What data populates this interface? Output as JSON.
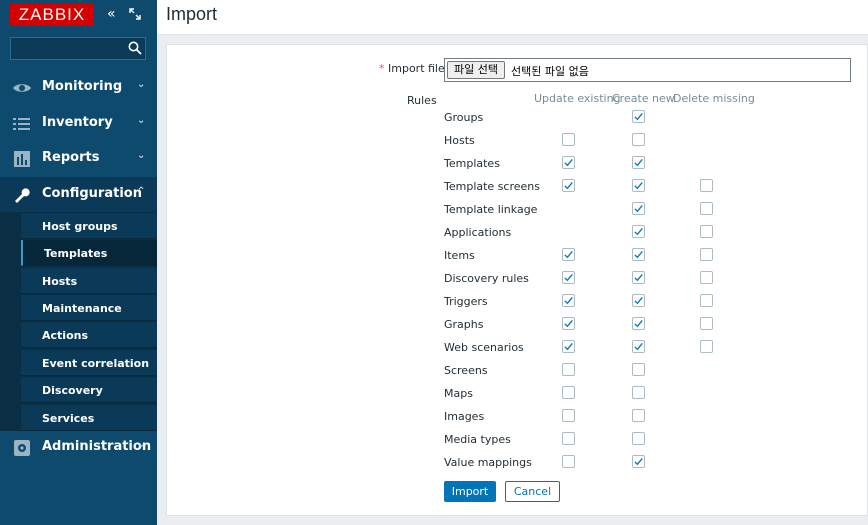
{
  "app": {
    "logo": "ZABBIX"
  },
  "page": {
    "title": "Import"
  },
  "search": {
    "placeholder": ""
  },
  "menu": [
    {
      "label": "Monitoring",
      "icon": "eye-icon"
    },
    {
      "label": "Inventory",
      "icon": "list-icon"
    },
    {
      "label": "Reports",
      "icon": "bar-chart-icon"
    },
    {
      "label": "Configuration",
      "icon": "wrench-icon"
    },
    {
      "label": "Administration",
      "icon": "gear-icon"
    }
  ],
  "submenu": [
    {
      "label": "Host groups"
    },
    {
      "label": "Templates"
    },
    {
      "label": "Hosts"
    },
    {
      "label": "Maintenance"
    },
    {
      "label": "Actions"
    },
    {
      "label": "Event correlation"
    },
    {
      "label": "Discovery"
    },
    {
      "label": "Services"
    }
  ],
  "form": {
    "required_mark": "*",
    "import_file_label": "Import file",
    "file_button": "파일 선택",
    "file_status": "선택된 파일 없음",
    "rules_label": "Rules",
    "columns": [
      "Update existing",
      "Create new",
      "Delete missing"
    ],
    "rules": [
      {
        "name": "Groups",
        "update": null,
        "create": true,
        "delete": null
      },
      {
        "name": "Hosts",
        "update": false,
        "create": false,
        "delete": null
      },
      {
        "name": "Templates",
        "update": true,
        "create": true,
        "delete": null
      },
      {
        "name": "Template screens",
        "update": true,
        "create": true,
        "delete": false
      },
      {
        "name": "Template linkage",
        "update": null,
        "create": true,
        "delete": false
      },
      {
        "name": "Applications",
        "update": null,
        "create": true,
        "delete": false
      },
      {
        "name": "Items",
        "update": true,
        "create": true,
        "delete": false
      },
      {
        "name": "Discovery rules",
        "update": true,
        "create": true,
        "delete": false
      },
      {
        "name": "Triggers",
        "update": true,
        "create": true,
        "delete": false
      },
      {
        "name": "Graphs",
        "update": true,
        "create": true,
        "delete": false
      },
      {
        "name": "Web scenarios",
        "update": true,
        "create": true,
        "delete": false
      },
      {
        "name": "Screens",
        "update": false,
        "create": false,
        "delete": null
      },
      {
        "name": "Maps",
        "update": false,
        "create": false,
        "delete": null
      },
      {
        "name": "Images",
        "update": false,
        "create": false,
        "delete": null
      },
      {
        "name": "Media types",
        "update": false,
        "create": false,
        "delete": null
      },
      {
        "name": "Value mappings",
        "update": false,
        "create": true,
        "delete": null
      }
    ],
    "import_button": "Import",
    "cancel_button": "Cancel"
  },
  "colors": {
    "sidebar": "#0e4a6e",
    "accent": "#0275b8",
    "logo": "#d40000"
  }
}
